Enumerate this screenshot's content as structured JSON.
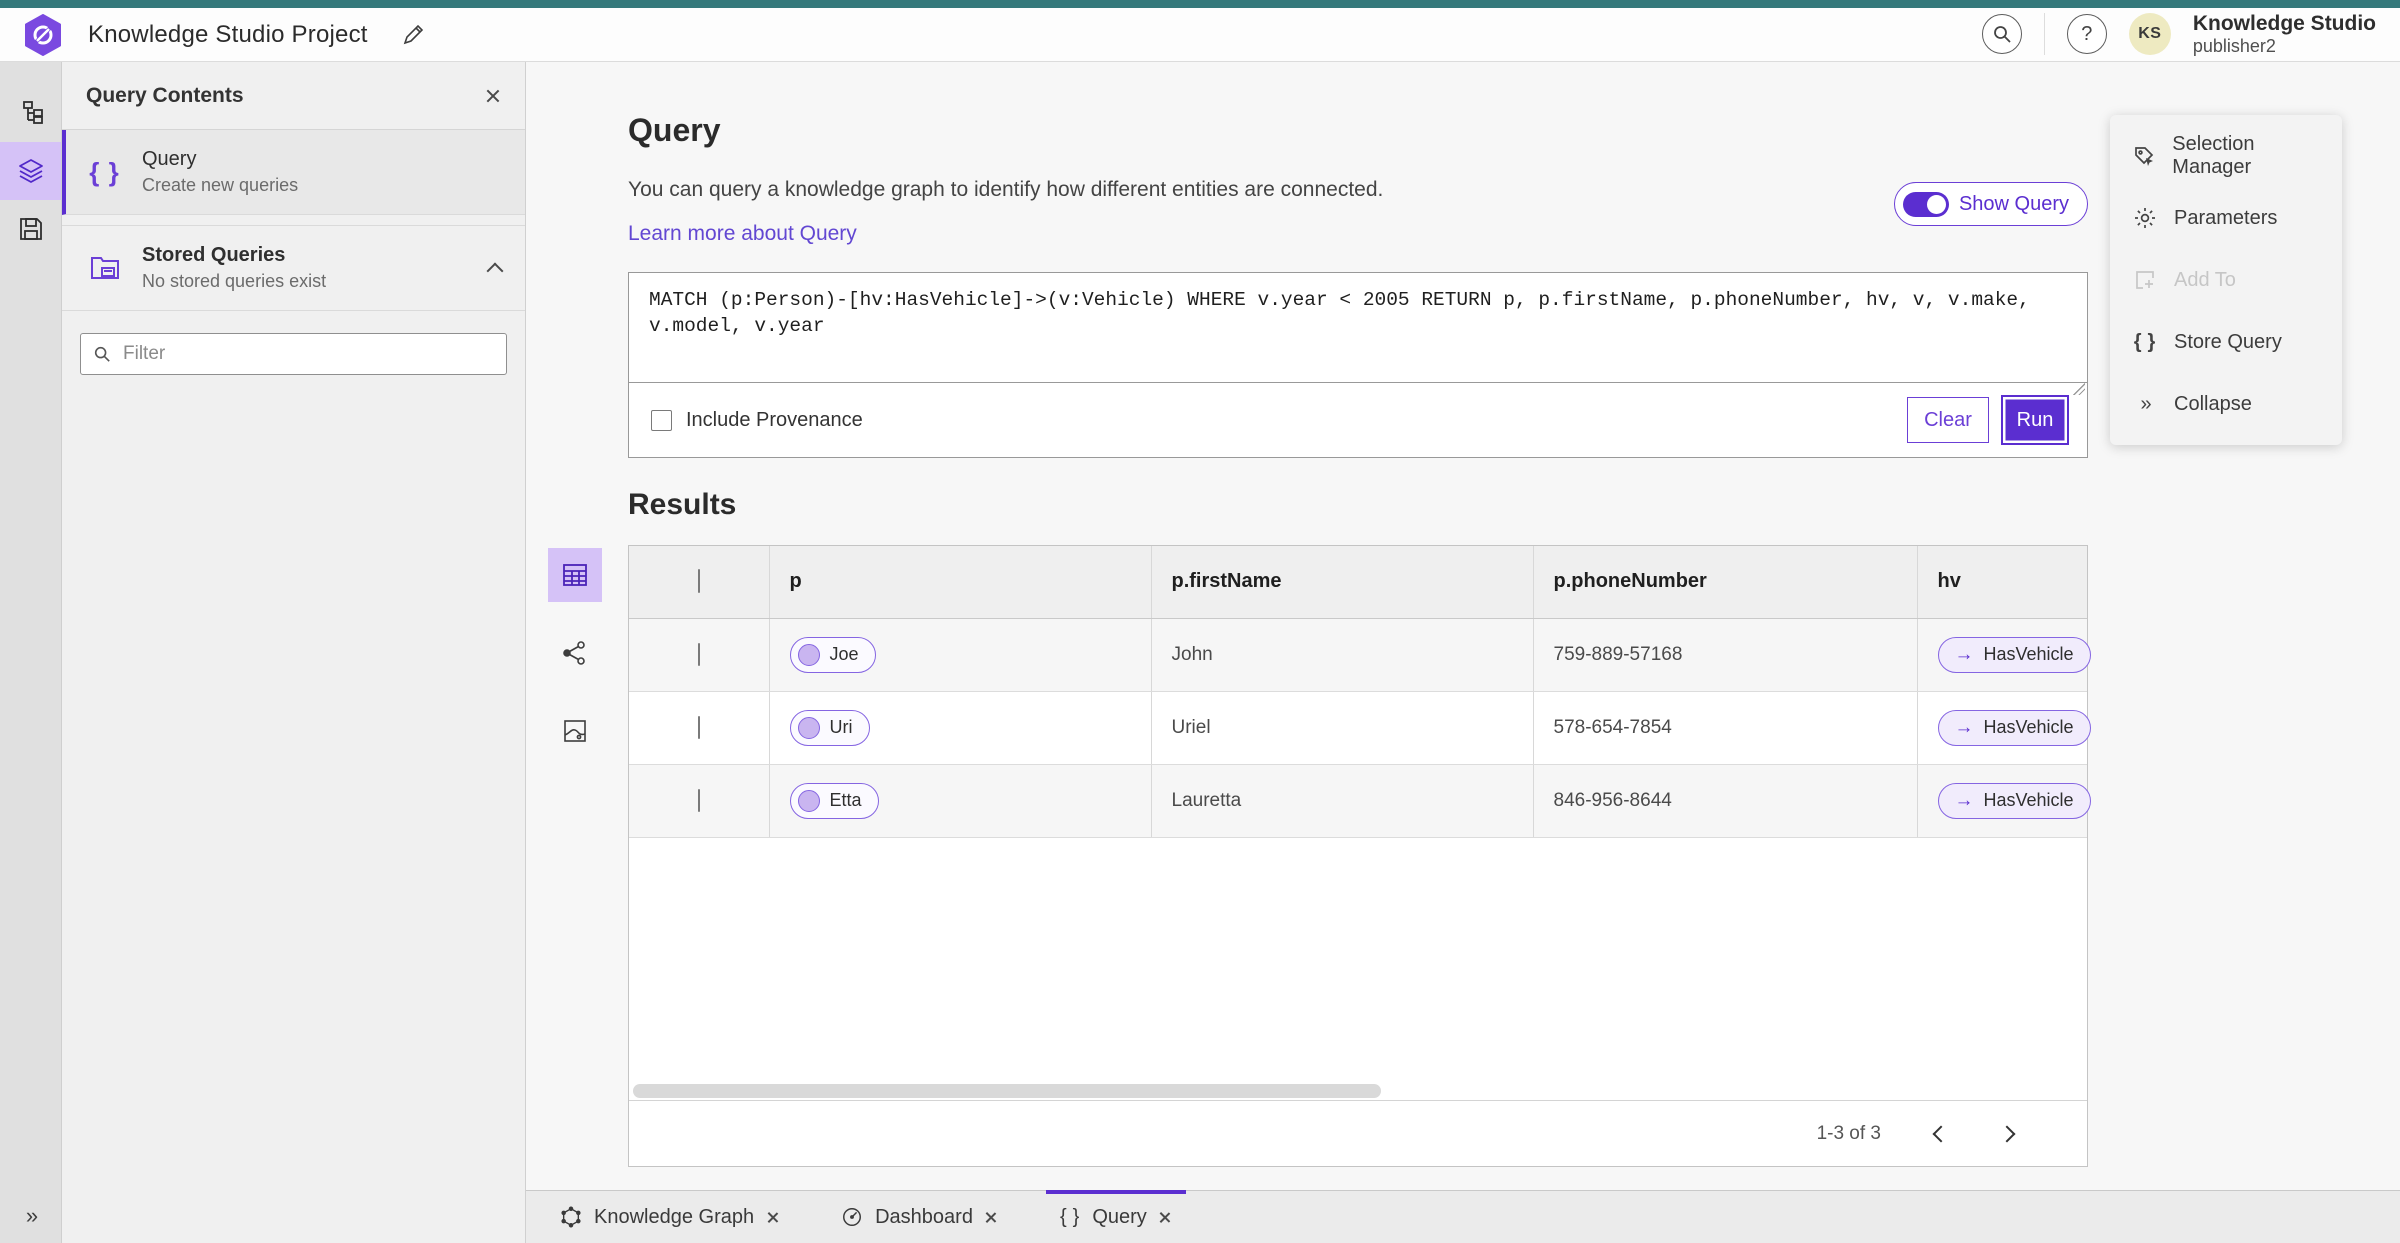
{
  "header": {
    "app_title": "Knowledge Studio Project",
    "user_name": "Knowledge Studio",
    "user_sub": "publisher2",
    "avatar_initials": "KS"
  },
  "panel": {
    "title": "Query Contents",
    "items": [
      {
        "label": "Query",
        "sublabel": "Create new queries"
      },
      {
        "label": "Stored Queries",
        "sublabel": "No stored queries exist"
      }
    ],
    "filter_placeholder": "Filter"
  },
  "query_section": {
    "title": "Query",
    "description": "You can query a knowledge graph to identify how different entities are connected.",
    "learn_more": "Learn more about Query",
    "show_query_label": "Show Query",
    "query_text": "MATCH (p:Person)-[hv:HasVehicle]->(v:Vehicle) WHERE v.year < 2005 RETURN p, p.firstName, p.phoneNumber, hv, v, v.make, v.model, v.year",
    "include_provenance_label": "Include Provenance",
    "clear_label": "Clear",
    "run_label": "Run"
  },
  "tools_menu": {
    "items": [
      {
        "label": "Selection Manager"
      },
      {
        "label": "Parameters"
      },
      {
        "label": "Add To"
      },
      {
        "label": "Store Query"
      },
      {
        "label": "Collapse"
      }
    ]
  },
  "results": {
    "title": "Results",
    "columns": [
      "p",
      "p.firstName",
      "p.phoneNumber",
      "hv"
    ],
    "rows": [
      {
        "p": "Joe",
        "firstName": "John",
        "phoneNumber": "759-889-57168",
        "hv": "HasVehicle",
        "arrow": "→"
      },
      {
        "p": "Uri",
        "firstName": "Uriel",
        "phoneNumber": "578-654-7854",
        "hv": "HasVehicle",
        "arrow": "→"
      },
      {
        "p": "Etta",
        "firstName": "Lauretta",
        "phoneNumber": "846-956-8644",
        "hv": "HasVehicle",
        "arrow": "→"
      }
    ],
    "pagination": "1-3 of 3"
  },
  "tabs": [
    {
      "label": "Knowledge Graph"
    },
    {
      "label": "Dashboard"
    },
    {
      "label": "Query"
    }
  ],
  "colors": {
    "accent_purple": "#5b2ed0",
    "accent_light_purple": "#d5c2f7",
    "teal_strip": "#35797b",
    "avatar_bg": "#eeeac1",
    "pill_border": "#8565e2",
    "pill_dot": "#c9b5f0"
  }
}
